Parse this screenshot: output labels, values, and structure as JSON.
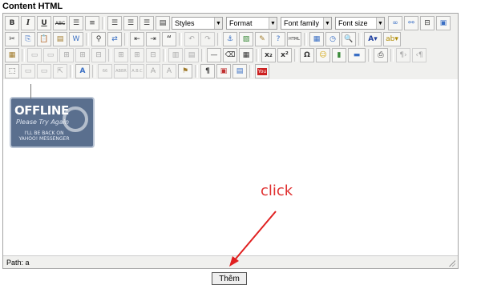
{
  "section_title": "Content HTML",
  "toolbar": {
    "styles_label": "Styles",
    "format_label": "Format",
    "font_family_label": "Font family",
    "font_size_label": "Font size",
    "bold": "B",
    "italic": "I",
    "underline": "U",
    "strike": "ABC",
    "sub": "x₂",
    "sup": "x²",
    "omega": "Ω",
    "blockquote": "“",
    "html": "HTML",
    "pilcrow": "¶"
  },
  "content": {
    "sign_title": "OFFLINE",
    "sign_subtitle": "Please Try Again",
    "sign_back_line1": "I'LL BE BACK ON",
    "sign_back_line2": "YAHOO! MESSENGER"
  },
  "statusbar": {
    "path": "Path: a"
  },
  "annotation": {
    "text": "click"
  },
  "submit_label": "Thêm"
}
